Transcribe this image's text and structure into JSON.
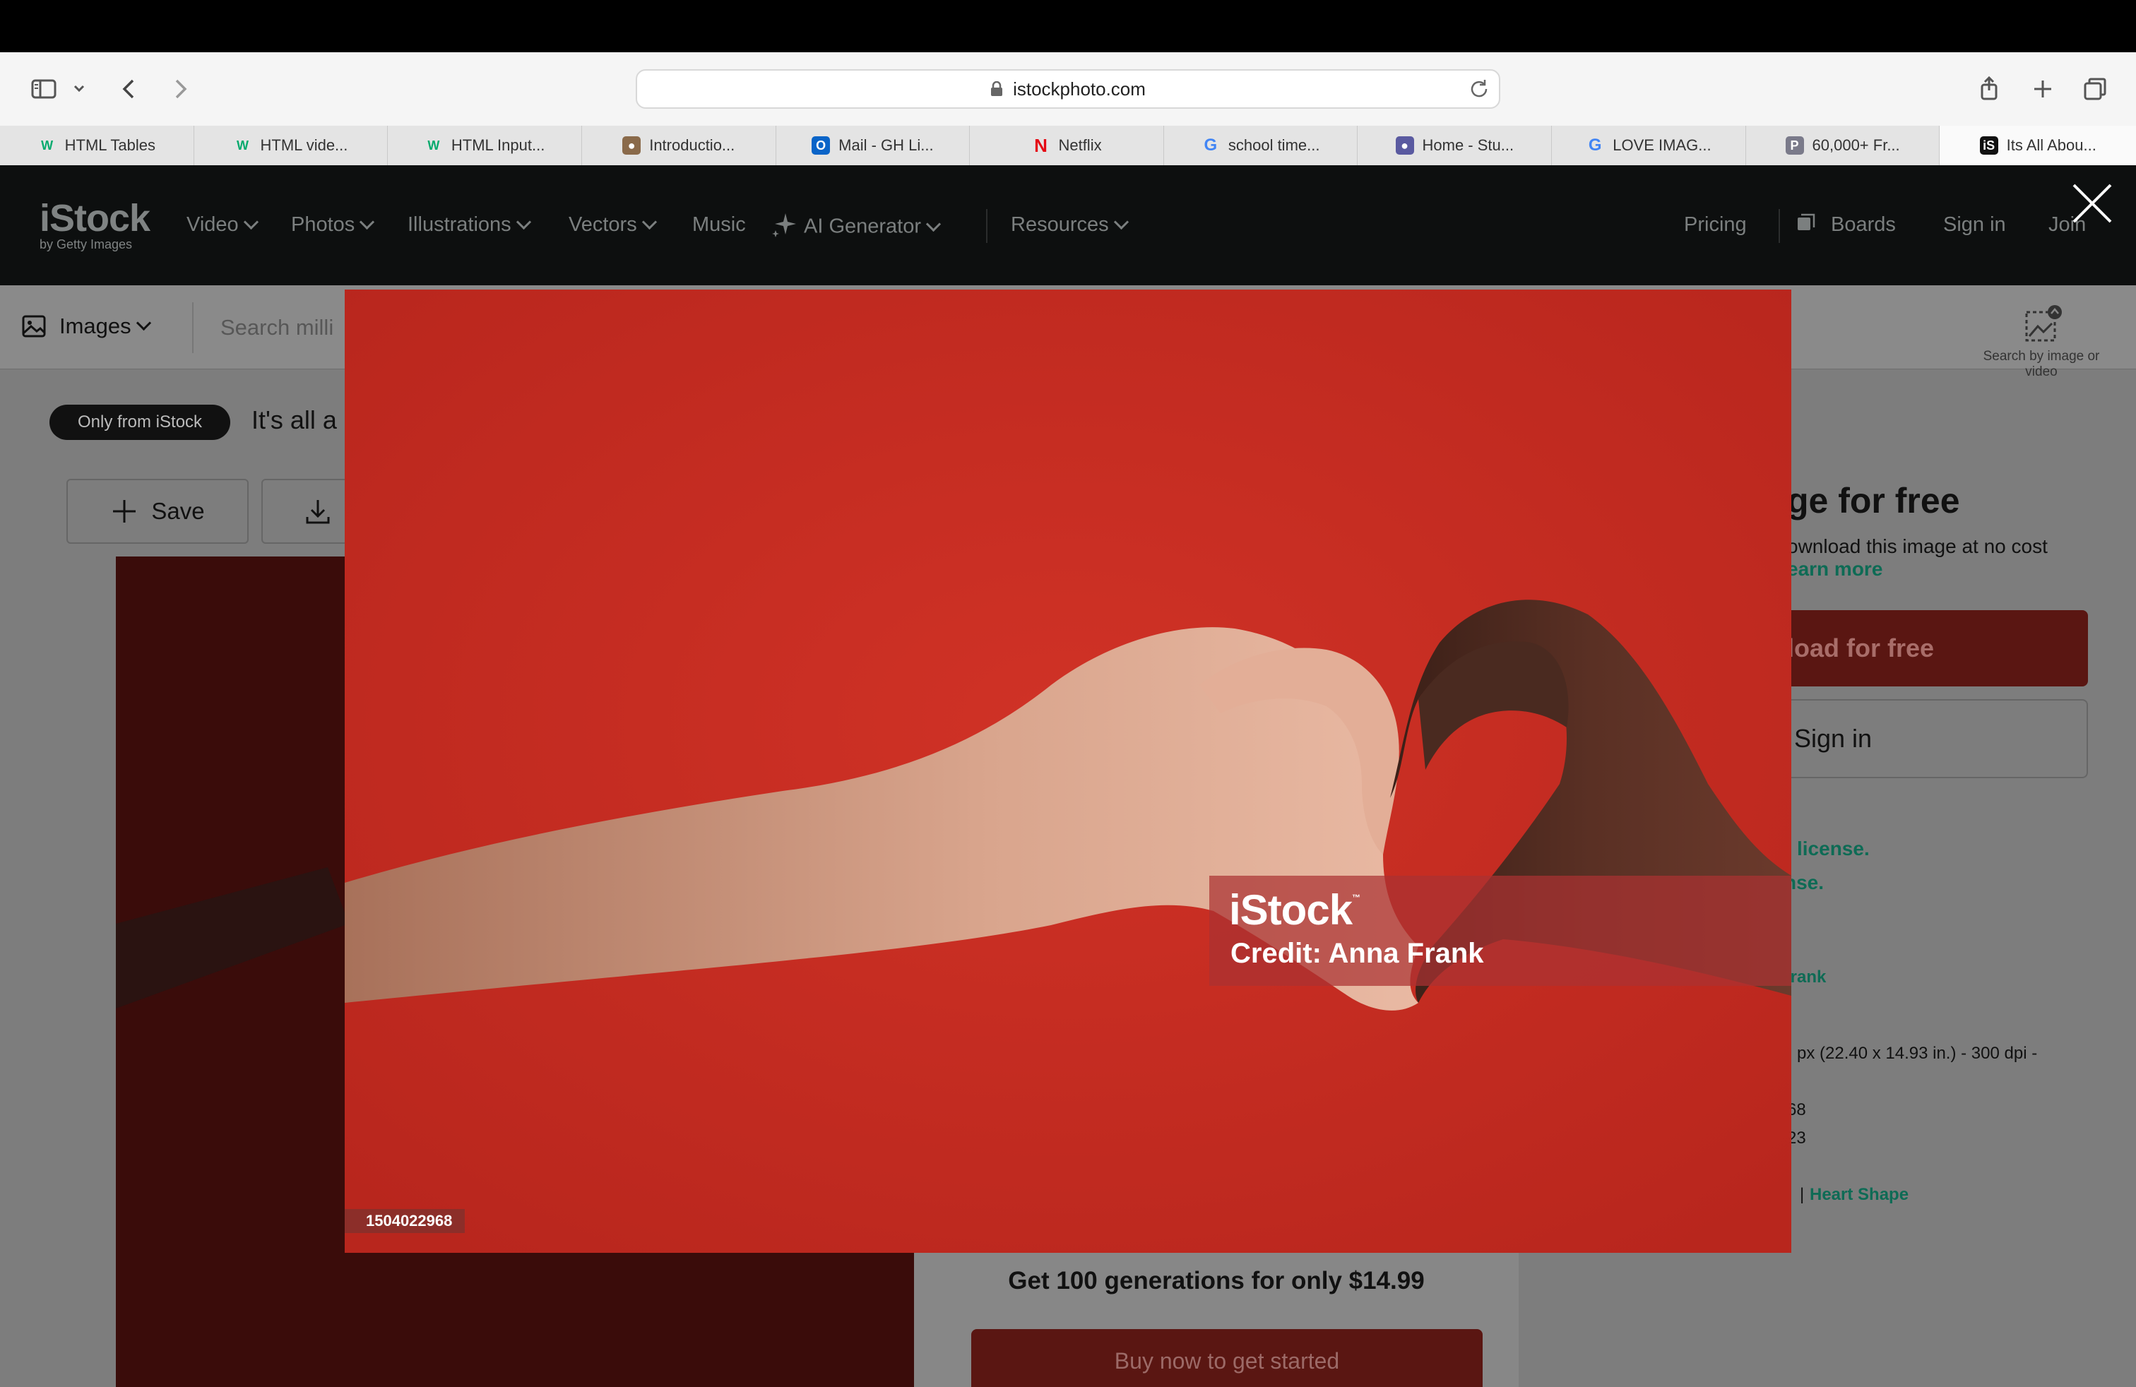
{
  "browser": {
    "address": "istockphoto.com",
    "tabs": [
      {
        "label": "HTML Tables",
        "icon": "w3schools-icon",
        "color": "#04aa6d"
      },
      {
        "label": "HTML vide...",
        "icon": "w3schools-icon",
        "color": "#04aa6d"
      },
      {
        "label": "HTML Input...",
        "icon": "w3schools-icon",
        "color": "#04aa6d"
      },
      {
        "label": "Introductio...",
        "icon": "site-icon",
        "color": "#8a6a4a"
      },
      {
        "label": "Mail - GH Li...",
        "icon": "outlook-icon",
        "color": "#0a64c8"
      },
      {
        "label": "Netflix",
        "icon": "netflix-icon",
        "color": "#e50914"
      },
      {
        "label": "school time...",
        "icon": "google-icon",
        "color": "#4285f4"
      },
      {
        "label": "Home - Stu...",
        "icon": "site-icon",
        "color": "#5a5aa0"
      },
      {
        "label": "LOVE IMAG...",
        "icon": "google-icon",
        "color": "#4285f4"
      },
      {
        "label": "60,000+ Fr...",
        "icon": "pexels-icon",
        "color": "#7a7a8a"
      },
      {
        "label": "Its All Abou...",
        "icon": "istock-icon",
        "color": "#111111"
      }
    ]
  },
  "nav": {
    "logo": "iStock",
    "logo_sub": "by Getty Images",
    "items": [
      "Video",
      "Photos",
      "Illustrations",
      "Vectors",
      "Music",
      "AI Generator",
      "Resources"
    ],
    "pricing": "Pricing",
    "boards": "Boards",
    "signin": "Sign in",
    "join": "Join"
  },
  "search": {
    "type_label": "Images",
    "placeholder": "Search milli",
    "by_image": "Search by image or video"
  },
  "page": {
    "badge": "Only from iStock",
    "heading": "It's all a",
    "save": "Save",
    "promo_text": "Get 100 generations for only $14.99",
    "promo_button": "Buy now to get started"
  },
  "right_panel": {
    "heading": "ge for free",
    "sub": "ownload this image at no cost",
    "learn_more": "earn more",
    "download": "load for free",
    "signin": "Sign in",
    "license1": "license.",
    "license2": "nse.",
    "credit": "a Frank",
    "size": "px (22.40 x 14.93 in.) - 300 dpi -",
    "id": "68",
    "date": "23",
    "kw_pre": "s",
    "kw": "Heart Shape"
  },
  "modal": {
    "watermark_logo": "iStock",
    "watermark_credit": "Credit: Anna Frank",
    "image_id": "1504022968"
  },
  "colors": {
    "modal_red": "#c42b21",
    "brand_green": "#0e6b55"
  }
}
